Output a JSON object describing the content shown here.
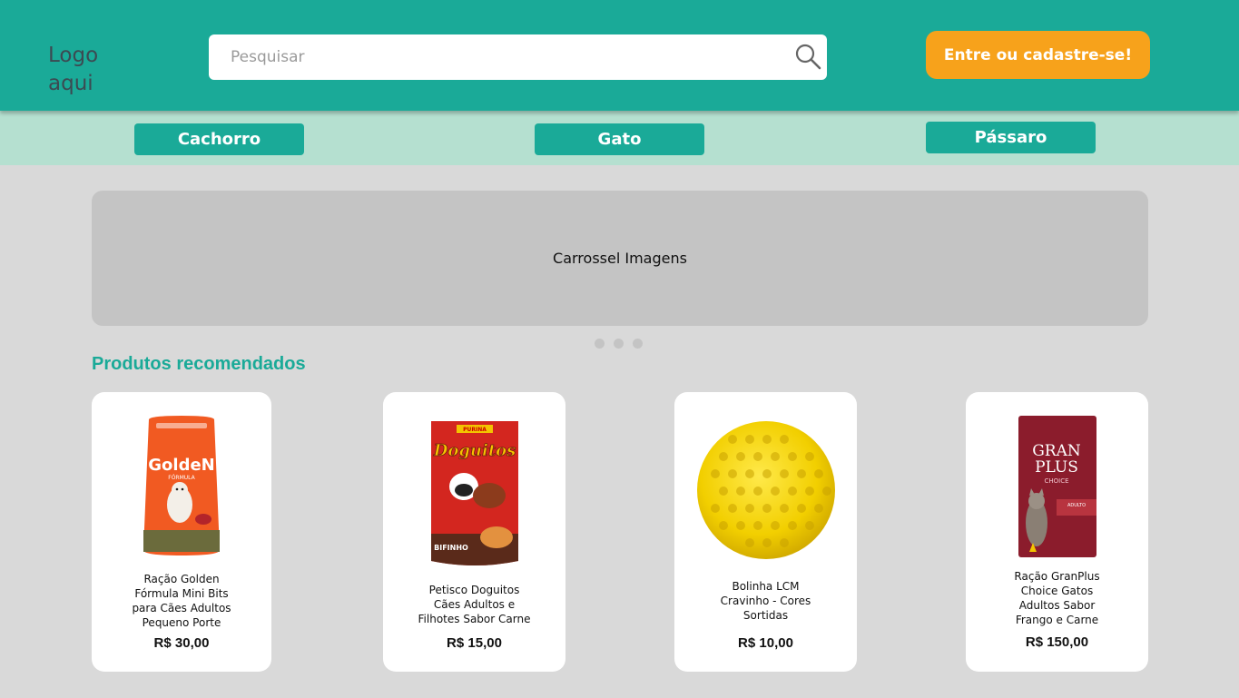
{
  "header": {
    "logo_text": "Logo aqui",
    "search_placeholder": "Pesquisar",
    "login_label": "Entre ou cadastre-se!"
  },
  "categories": [
    {
      "label": "Cachorro"
    },
    {
      "label": "Gato"
    },
    {
      "label": "Pássaro"
    }
  ],
  "carousel": {
    "label": "Carrossel Imagens",
    "dots": 3
  },
  "recommended": {
    "title": "Produtos recomendados",
    "products": [
      {
        "name": "Ração Golden Fórmula Mini Bits para Cães Adultos Pequeno Porte",
        "price": "R$ 30,00"
      },
      {
        "name": "Petisco Doguitos Cães Adultos e Filhotes Sabor Carne",
        "price": "R$ 15,00"
      },
      {
        "name": "Bolinha LCM Cravinho - Cores Sortidas",
        "price": "R$ 10,00"
      },
      {
        "name": "Ração GranPlus Choice Gatos Adultos Sabor Frango e Carne",
        "price": "R$ 150,00"
      }
    ]
  },
  "colors": {
    "primary": "#1aaa98",
    "accent": "#f7a21b",
    "category_bar": "#b5e0d0",
    "background": "#d9d9d9"
  }
}
